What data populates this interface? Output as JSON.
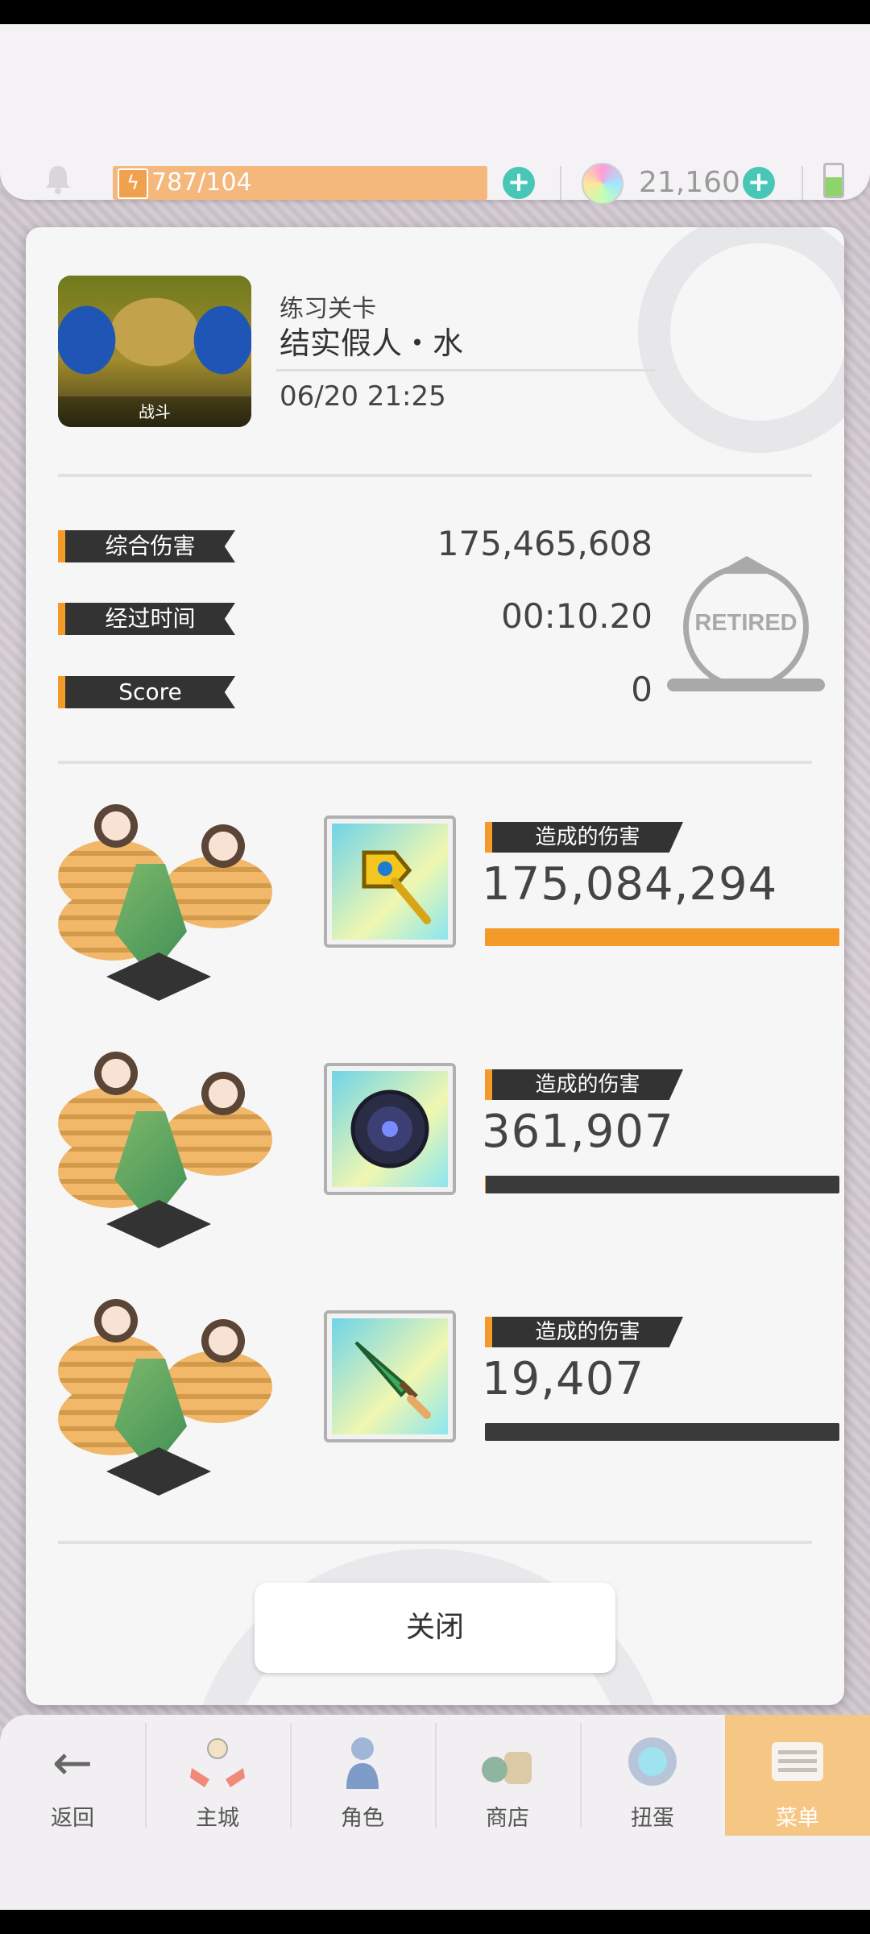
{
  "top_bar": {
    "stamina": "787/104",
    "gems": "21,160",
    "stamina_plus": "+",
    "gems_plus": "+"
  },
  "stage": {
    "type": "练习关卡",
    "name": "结实假人・水",
    "date": "06/20 21:25",
    "thumb_label": "战斗"
  },
  "stats": {
    "damage_label": "综合伤害",
    "damage_value": "175,465,608",
    "time_label": "经过时间",
    "time_value": "00:10.20",
    "score_label": "Score",
    "score_value": "0",
    "retired": "RETIRED"
  },
  "units": [
    {
      "tag": "造成的伤害",
      "damage": "175,084,294",
      "bar_fraction": 1.0,
      "weapon_icon": "golden-axe-icon"
    },
    {
      "tag": "造成的伤害",
      "damage": "361,907",
      "bar_fraction": 0.002,
      "weapon_icon": "dark-shield-icon"
    },
    {
      "tag": "造成的伤害",
      "damage": "19,407",
      "bar_fraction": 0.0001,
      "weapon_icon": "green-sword-icon"
    }
  ],
  "close_label": "关闭",
  "nav": {
    "back": "返回",
    "city": "主城",
    "chara": "角色",
    "shop": "商店",
    "gacha": "扭蛋",
    "menu": "菜单"
  },
  "colors": {
    "accent_orange": "#f39a28",
    "teal_plus": "#48c7b8",
    "menu_highlight": "#f6c684"
  }
}
